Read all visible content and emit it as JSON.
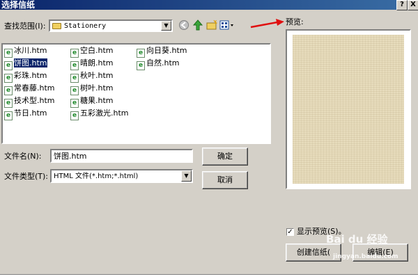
{
  "window": {
    "title": "选择信纸",
    "help_glyph": "?",
    "close_glyph": "X"
  },
  "lookin": {
    "label": "查找范围(I):",
    "value": "Stationery",
    "dropdown_glyph": "▼"
  },
  "toolbar": {
    "back_icon": "back-arrow-icon",
    "up_icon": "up-folder-icon",
    "new_folder_icon": "new-folder-icon",
    "view_menu_icon": "view-menu-icon"
  },
  "files": {
    "col1": [
      {
        "name": "冰川.htm",
        "selected": false
      },
      {
        "name": "饼图.htm",
        "selected": true
      },
      {
        "name": "彩珠.htm",
        "selected": false
      },
      {
        "name": "常春藤.htm",
        "selected": false
      },
      {
        "name": "技术型.htm",
        "selected": false
      },
      {
        "name": "节日.htm",
        "selected": false
      }
    ],
    "col2": [
      {
        "name": "空白.htm",
        "selected": false
      },
      {
        "name": "晴朗.htm",
        "selected": false
      },
      {
        "name": "秋叶.htm",
        "selected": false
      },
      {
        "name": "树叶.htm",
        "selected": false
      },
      {
        "name": "糖果.htm",
        "selected": false
      },
      {
        "name": "五彩激光.htm",
        "selected": false
      }
    ],
    "col3": [
      {
        "name": "向日葵.htm",
        "selected": false
      },
      {
        "name": "自然.htm",
        "selected": false
      }
    ]
  },
  "filename": {
    "label": "文件名(N):",
    "value": "饼图.htm"
  },
  "filetype": {
    "label": "文件类型(T):",
    "value": "HTML 文件(*.htm;*.html)",
    "dropdown_glyph": "▼"
  },
  "buttons": {
    "ok": "确定",
    "cancel": "取消",
    "create": "创建信纸(",
    "edit": "编辑(E)"
  },
  "preview": {
    "label": "预览:",
    "show_label": "显示预览(S)。",
    "show_checked": true,
    "check_glyph": "✓"
  },
  "watermark": {
    "brand": "Bai du 经验",
    "url": "jingyan.baidu.com"
  },
  "colors": {
    "dialog_bg": "#d4d0c8",
    "title_bar": "#0a246a",
    "selection": "#0a246a",
    "arrow_red": "#e01010",
    "paper": "#e7dcbc"
  }
}
